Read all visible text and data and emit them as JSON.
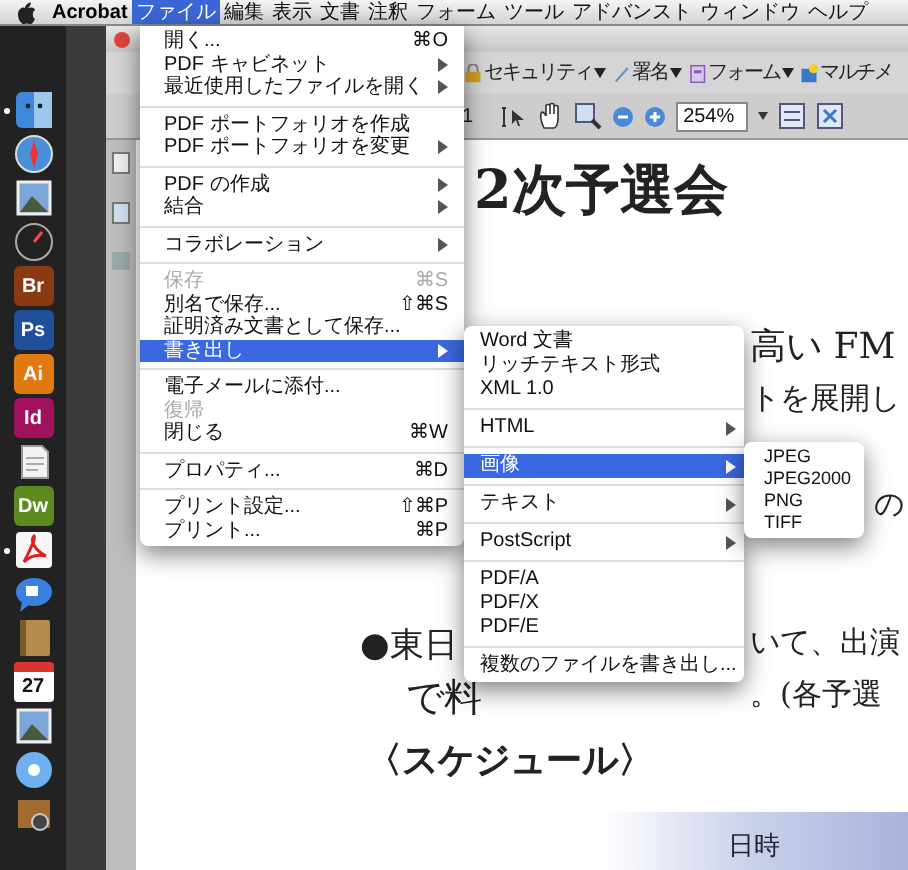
{
  "menubar": {
    "app": "Acrobat",
    "menus": [
      {
        "label": "ファイル",
        "selected": true
      },
      {
        "label": "編集",
        "selected": false
      },
      {
        "label": "表示",
        "selected": false
      },
      {
        "label": "文書",
        "selected": false
      },
      {
        "label": "注釈",
        "selected": false
      },
      {
        "label": "フォーム",
        "selected": false
      },
      {
        "label": "ツール",
        "selected": false
      },
      {
        "label": "アドバンスト",
        "selected": false
      },
      {
        "label": "ウィンドウ",
        "selected": false
      },
      {
        "label": "ヘルプ",
        "selected": false
      }
    ]
  },
  "dock": [
    {
      "kind": "finder",
      "running": true
    },
    {
      "kind": "compass",
      "running": false
    },
    {
      "kind": "photo",
      "running": false
    },
    {
      "kind": "gauge",
      "running": false
    },
    {
      "kind": "tile",
      "label": "Br",
      "color": "#8a3a12",
      "running": false
    },
    {
      "kind": "tile",
      "label": "Ps",
      "color": "#1f4f9a",
      "running": false
    },
    {
      "kind": "tile",
      "label": "Ai",
      "color": "#e07a10",
      "running": false
    },
    {
      "kind": "tile",
      "label": "Id",
      "color": "#a0125e",
      "running": false
    },
    {
      "kind": "paper",
      "running": false
    },
    {
      "kind": "tile",
      "label": "Dw",
      "color": "#5c8a1c",
      "running": false
    },
    {
      "kind": "acrobat",
      "running": true
    },
    {
      "kind": "bubble",
      "running": false
    },
    {
      "kind": "book",
      "running": false
    },
    {
      "kind": "calendar",
      "label": "27",
      "running": false
    },
    {
      "kind": "photo",
      "running": false
    },
    {
      "kind": "disc",
      "running": false
    },
    {
      "kind": "camera",
      "running": false
    }
  ],
  "toolbar": {
    "tools": [
      {
        "label": "セキュリティ",
        "dropdown": true
      },
      {
        "label": "署名",
        "dropdown": true
      },
      {
        "label": "フォーム",
        "dropdown": true
      },
      {
        "label": "マルチメ",
        "dropdown": false
      }
    ],
    "page": "1",
    "zoom": "254%"
  },
  "file_menu": [
    {
      "kind": "item",
      "label": "開く...",
      "shortcut": "⌘O",
      "submenu": false,
      "disabled": false,
      "selected": false
    },
    {
      "kind": "item",
      "label": "PDF キャビネット",
      "submenu": true,
      "disabled": false,
      "selected": false
    },
    {
      "kind": "item",
      "label": "最近使用したファイルを開く",
      "submenu": true,
      "disabled": false,
      "selected": false
    },
    {
      "kind": "separator"
    },
    {
      "kind": "item",
      "label": "PDF ポートフォリオを作成",
      "submenu": false,
      "disabled": false,
      "selected": false
    },
    {
      "kind": "item",
      "label": "PDF ポートフォリオを変更",
      "submenu": true,
      "disabled": false,
      "selected": false
    },
    {
      "kind": "separator"
    },
    {
      "kind": "item",
      "label": "PDF の作成",
      "submenu": true,
      "disabled": false,
      "selected": false
    },
    {
      "kind": "item",
      "label": "結合",
      "submenu": true,
      "disabled": false,
      "selected": false
    },
    {
      "kind": "separator"
    },
    {
      "kind": "item",
      "label": "コラボレーション",
      "submenu": true,
      "disabled": false,
      "selected": false
    },
    {
      "kind": "separator"
    },
    {
      "kind": "item",
      "label": "保存",
      "shortcut": "⌘S",
      "submenu": false,
      "disabled": true,
      "selected": false
    },
    {
      "kind": "item",
      "label": "別名で保存...",
      "shortcut": "⇧⌘S",
      "submenu": false,
      "disabled": false,
      "selected": false
    },
    {
      "kind": "item",
      "label": "証明済み文書として保存...",
      "submenu": false,
      "disabled": false,
      "selected": false
    },
    {
      "kind": "item",
      "label": "書き出し",
      "submenu": true,
      "disabled": false,
      "selected": true
    },
    {
      "kind": "separator"
    },
    {
      "kind": "item",
      "label": "電子メールに添付...",
      "submenu": false,
      "disabled": false,
      "selected": false
    },
    {
      "kind": "item",
      "label": "復帰",
      "submenu": false,
      "disabled": true,
      "selected": false
    },
    {
      "kind": "item",
      "label": "閉じる",
      "shortcut": "⌘W",
      "submenu": false,
      "disabled": false,
      "selected": false
    },
    {
      "kind": "separator"
    },
    {
      "kind": "item",
      "label": "プロパティ...",
      "shortcut": "⌘D",
      "submenu": false,
      "disabled": false,
      "selected": false
    },
    {
      "kind": "separator"
    },
    {
      "kind": "item",
      "label": "プリント設定...",
      "shortcut": "⇧⌘P",
      "submenu": false,
      "disabled": false,
      "selected": false
    },
    {
      "kind": "item",
      "label": "プリント...",
      "shortcut": "⌘P",
      "submenu": false,
      "disabled": false,
      "selected": false
    }
  ],
  "export_menu": [
    {
      "kind": "item",
      "label": "Word 文書",
      "submenu": false,
      "disabled": false,
      "selected": false
    },
    {
      "kind": "item",
      "label": "リッチテキスト形式",
      "submenu": false,
      "disabled": false,
      "selected": false
    },
    {
      "kind": "item",
      "label": "XML 1.0",
      "submenu": false,
      "disabled": false,
      "selected": false
    },
    {
      "kind": "separator"
    },
    {
      "kind": "item",
      "label": "HTML",
      "submenu": true,
      "disabled": false,
      "selected": false
    },
    {
      "kind": "separator"
    },
    {
      "kind": "item",
      "label": "画像",
      "submenu": true,
      "disabled": false,
      "selected": true
    },
    {
      "kind": "separator"
    },
    {
      "kind": "item",
      "label": "テキスト",
      "submenu": true,
      "disabled": false,
      "selected": false
    },
    {
      "kind": "separator"
    },
    {
      "kind": "item",
      "label": "PostScript",
      "submenu": true,
      "disabled": false,
      "selected": false
    },
    {
      "kind": "separator"
    },
    {
      "kind": "item",
      "label": "PDF/A",
      "submenu": false,
      "disabled": false,
      "selected": false
    },
    {
      "kind": "item",
      "label": "PDF/X",
      "submenu": false,
      "disabled": false,
      "selected": false
    },
    {
      "kind": "item",
      "label": "PDF/E",
      "submenu": false,
      "disabled": false,
      "selected": false
    },
    {
      "kind": "separator"
    },
    {
      "kind": "item",
      "label": "複数のファイルを書き出し...",
      "submenu": false,
      "disabled": false,
      "selected": false
    }
  ],
  "image_menu": [
    {
      "kind": "item",
      "label": "JPEG",
      "submenu": false,
      "disabled": false,
      "selected": false
    },
    {
      "kind": "item",
      "label": "JPEG2000",
      "submenu": false,
      "disabled": false,
      "selected": false
    },
    {
      "kind": "item",
      "label": "PNG",
      "submenu": false,
      "disabled": false,
      "selected": false
    },
    {
      "kind": "item",
      "label": "TIFF",
      "submenu": false,
      "disabled": false,
      "selected": false
    }
  ],
  "document": {
    "heading": "2次予選会",
    "fragments": [
      "高い FM",
      "トを展開し",
      "の",
      "●東日",
      "いて、出演",
      "で料",
      "。(各予選"
    ],
    "section_heading": "〈スケジュール〉",
    "table": {
      "columns": [
        "日時"
      ]
    }
  }
}
